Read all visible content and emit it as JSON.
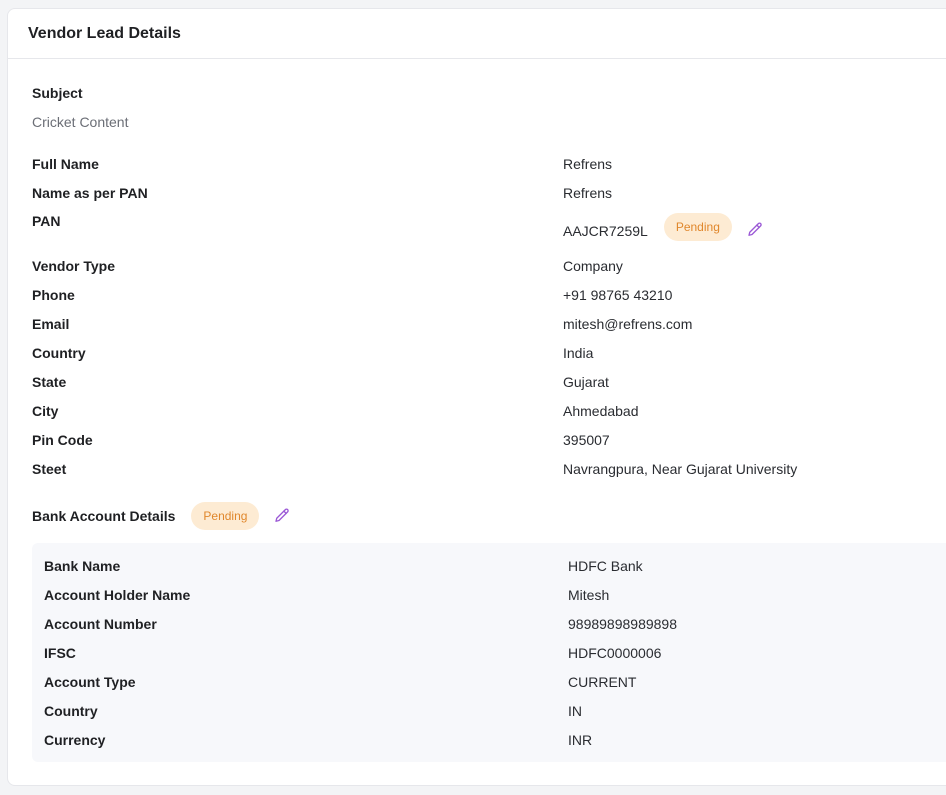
{
  "header": {
    "title": "Vendor Lead Details"
  },
  "subject": {
    "label": "Subject",
    "value": "Cricket Content"
  },
  "details": [
    {
      "label": "Full Name",
      "value": "Refrens"
    },
    {
      "label": "Name as per PAN",
      "value": "Refrens"
    },
    {
      "label": "PAN",
      "value": "AAJCR7259L",
      "status": "Pending"
    },
    {
      "label": "Vendor Type",
      "value": "Company"
    },
    {
      "label": "Phone",
      "value": "+91 98765 43210"
    },
    {
      "label": "Email",
      "value": "mitesh@refrens.com"
    },
    {
      "label": "Country",
      "value": "India"
    },
    {
      "label": "State",
      "value": "Gujarat"
    },
    {
      "label": "City",
      "value": "Ahmedabad"
    },
    {
      "label": "Pin Code",
      "value": "395007"
    },
    {
      "label": "Steet",
      "value": "Navrangpura, Near Gujarat University"
    }
  ],
  "bank": {
    "title": "Bank Account Details",
    "status": "Pending",
    "rows": [
      {
        "label": "Bank Name",
        "value": "HDFC Bank"
      },
      {
        "label": "Account Holder Name",
        "value": "Mitesh"
      },
      {
        "label": "Account Number",
        "value": "98989898989898"
      },
      {
        "label": "IFSC",
        "value": "HDFC0000006"
      },
      {
        "label": "Account Type",
        "value": "CURRENT"
      },
      {
        "label": "Country",
        "value": "IN"
      },
      {
        "label": "Currency",
        "value": "INR"
      }
    ]
  },
  "colors": {
    "badge_bg": "#fdebd3",
    "badge_text": "#e0872c",
    "edit_icon": "#9b59d6",
    "bank_box_bg": "#f7f8fb"
  },
  "icons": {
    "edit": "pencil-icon"
  }
}
